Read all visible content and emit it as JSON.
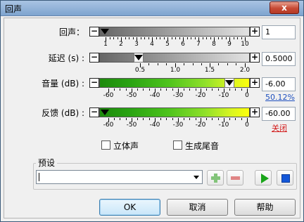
{
  "window": {
    "title": "回声",
    "close_label": "x"
  },
  "rows": [
    {
      "label": "回声：",
      "value": "1",
      "ticks": [
        "1",
        "2",
        "3",
        "4",
        "5",
        "6",
        "7",
        "8",
        "9",
        "10"
      ]
    },
    {
      "label": "延迟 (s) :",
      "value": "0.5000",
      "ticks": [
        "0.5",
        "1.0",
        "1.5",
        "2.0"
      ]
    },
    {
      "label": "音量 (dB) :",
      "value": "-6.00",
      "link": "50.12%",
      "ticks": [
        "-60",
        "-50",
        "-40",
        "-30",
        "-20",
        "-10",
        "0"
      ]
    },
    {
      "label": "反馈 (dB) :",
      "value": "-60.00",
      "link": "关闭",
      "ticks": [
        "-60",
        "-50",
        "-40",
        "-30",
        "-20",
        "-10",
        "0"
      ]
    }
  ],
  "options": {
    "stereo_label": "立体声",
    "tail_label": "生成尾音"
  },
  "preset": {
    "label": "预设",
    "value": ""
  },
  "buttons": {
    "ok": "OK",
    "cancel": "取消",
    "help": "帮助"
  },
  "symbols": {
    "minus": "−",
    "plus": "+"
  },
  "colors": {
    "accent_green": "#19a519",
    "stop_blue": "#1457d8",
    "link_blue": "#1d4fbf",
    "link_red": "#d21a1a"
  },
  "icons": [
    "add-preset-icon",
    "remove-preset-icon",
    "play-icon",
    "stop-icon"
  ]
}
